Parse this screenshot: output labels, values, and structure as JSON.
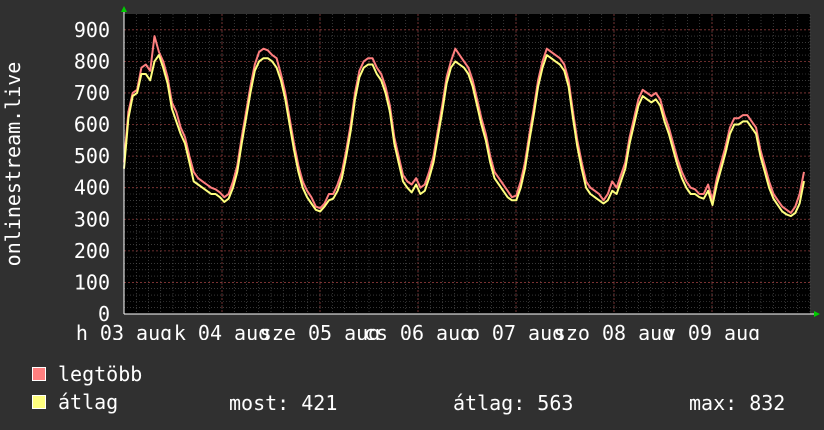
{
  "chart_data": {
    "type": "line",
    "ylabel": "onlinestream.live",
    "ylim": [
      0,
      950
    ],
    "y_ticks": [
      "0",
      "100",
      "200",
      "300",
      "400",
      "500",
      "600",
      "700",
      "800",
      "900"
    ],
    "x_tick_labels": [
      "h 03 aug",
      "k 04 aug",
      "sze 05 aug",
      "cs 06 aug",
      "p 07 aug",
      "szo 08 aug",
      "v 09 aug"
    ],
    "grid": true,
    "colors": {
      "max_series": "#ff7f7f",
      "avg_series": "#ffff7f",
      "background": "#000000",
      "frame": "#303030"
    },
    "series": [
      {
        "name": "legtöbb",
        "values": [
          480,
          640,
          700,
          710,
          780,
          790,
          770,
          880,
          830,
          800,
          750,
          670,
          640,
          590,
          560,
          500,
          450,
          430,
          420,
          410,
          400,
          395,
          385,
          370,
          380,
          420,
          470,
          560,
          640,
          720,
          790,
          830,
          840,
          835,
          820,
          810,
          760,
          700,
          620,
          540,
          470,
          420,
          390,
          370,
          340,
          335,
          350,
          380,
          380,
          410,
          450,
          520,
          600,
          700,
          770,
          800,
          810,
          810,
          780,
          760,
          720,
          660,
          560,
          500,
          440,
          420,
          410,
          430,
          400,
          410,
          450,
          500,
          580,
          660,
          750,
          800,
          840,
          820,
          800,
          780,
          740,
          680,
          620,
          570,
          500,
          450,
          430,
          410,
          390,
          370,
          375,
          420,
          480,
          570,
          650,
          740,
          800,
          840,
          830,
          820,
          810,
          790,
          740,
          640,
          550,
          480,
          420,
          400,
          390,
          380,
          360,
          380,
          420,
          400,
          440,
          480,
          560,
          620,
          680,
          710,
          700,
          690,
          700,
          680,
          630,
          590,
          540,
          490,
          450,
          420,
          400,
          395,
          380,
          380,
          410,
          360,
          430,
          480,
          530,
          590,
          620,
          620,
          630,
          630,
          610,
          590,
          520,
          470,
          420,
          380,
          360,
          340,
          330,
          320,
          340,
          380,
          450
        ]
      },
      {
        "name": "átlag",
        "values": [
          460,
          620,
          690,
          700,
          760,
          760,
          740,
          800,
          820,
          780,
          730,
          650,
          610,
          570,
          540,
          480,
          420,
          410,
          400,
          390,
          380,
          380,
          370,
          355,
          365,
          400,
          450,
          540,
          620,
          700,
          770,
          800,
          810,
          810,
          800,
          780,
          740,
          680,
          600,
          520,
          450,
          400,
          370,
          350,
          330,
          325,
          340,
          360,
          365,
          390,
          430,
          500,
          580,
          680,
          750,
          780,
          790,
          790,
          760,
          740,
          700,
          640,
          540,
          480,
          420,
          400,
          385,
          410,
          380,
          390,
          430,
          480,
          560,
          640,
          730,
          780,
          800,
          790,
          780,
          760,
          720,
          660,
          600,
          550,
          480,
          430,
          410,
          390,
          370,
          360,
          360,
          400,
          460,
          550,
          630,
          720,
          780,
          820,
          810,
          800,
          790,
          770,
          720,
          620,
          530,
          460,
          400,
          380,
          370,
          360,
          350,
          360,
          390,
          380,
          420,
          460,
          540,
          600,
          660,
          690,
          680,
          670,
          680,
          660,
          610,
          570,
          520,
          470,
          430,
          400,
          380,
          380,
          370,
          365,
          390,
          345,
          410,
          460,
          510,
          570,
          600,
          600,
          610,
          610,
          590,
          570,
          500,
          450,
          400,
          365,
          345,
          325,
          315,
          310,
          320,
          350,
          421
        ]
      }
    ]
  },
  "legend": [
    {
      "label": "legtöbb",
      "color": "#ff7f7f"
    },
    {
      "label": "átlag",
      "color": "#ffff7f"
    }
  ],
  "stats": {
    "most": "most: 421",
    "atlag": "átlag: 563",
    "max": "max: 832"
  }
}
